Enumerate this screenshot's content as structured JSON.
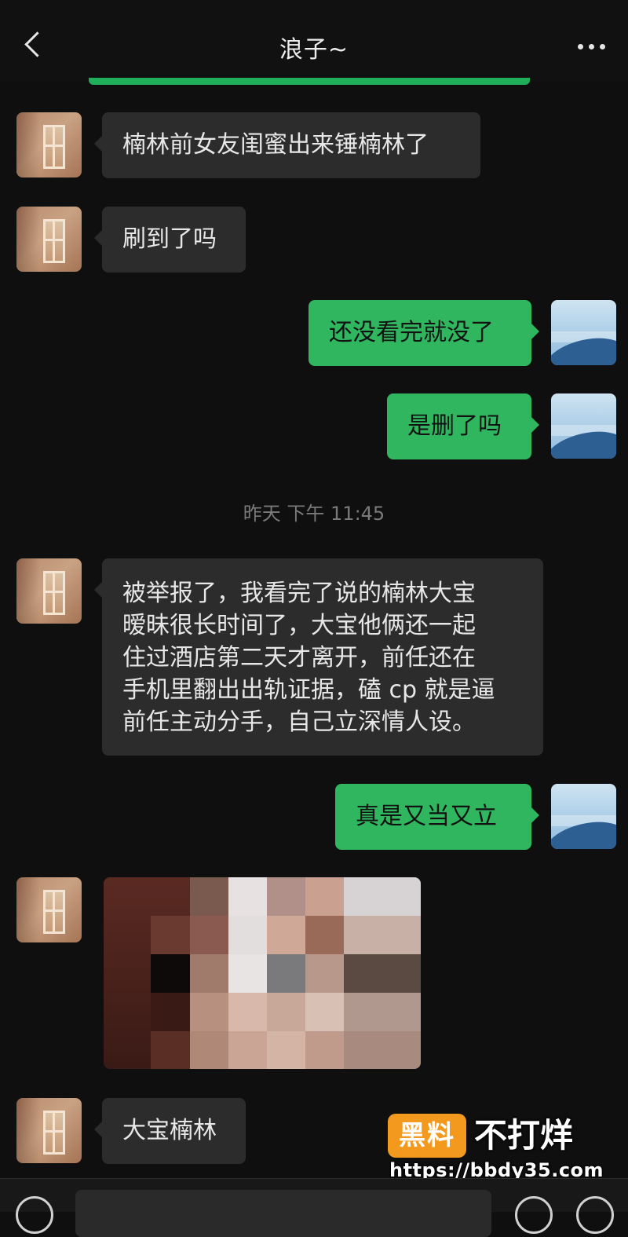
{
  "header": {
    "title": "浪子~"
  },
  "messages": [
    {
      "side": "in",
      "text": "楠林前女友闺蜜出来锤楠林了"
    },
    {
      "side": "in",
      "text": "刷到了吗"
    },
    {
      "side": "out",
      "text": "还没看完就没了"
    },
    {
      "side": "out",
      "text": "是删了吗"
    },
    {
      "side": "in",
      "text": "被举报了，我看完了说的楠林大宝\n暧昧很长时间了，大宝他俩还一起\n住过酒店第二天才离开，前任还在\n手机里翻出出轨证据，磕 cp 就是逼\n前任主动分手，自己立深情人设。"
    },
    {
      "side": "out",
      "text": "真是又当又立"
    },
    {
      "side": "in",
      "text": "大宝楠林"
    }
  ],
  "timestamp": "昨天 下午 11:45",
  "watermark": {
    "badge": "黑料",
    "title": "不打烊",
    "url": "https://bbdy35.com"
  },
  "colors": {
    "incoming_bubble": "#2c2c2c",
    "outgoing_bubble": "#2fb65e",
    "background": "#0f0f0f",
    "watermark_badge": "#f39a1e"
  }
}
